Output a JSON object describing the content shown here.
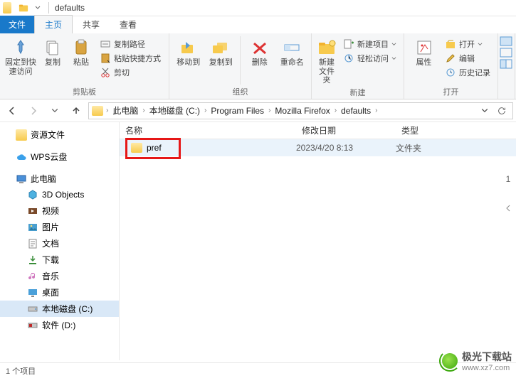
{
  "titlebar": {
    "title": "defaults"
  },
  "tabs": {
    "file": "文件",
    "home": "主页",
    "share": "共享",
    "view": "查看"
  },
  "ribbon": {
    "clipboard": {
      "pin": "固定到快\n速访问",
      "copy": "复制",
      "paste": "粘贴",
      "copy_path": "复制路径",
      "paste_shortcut": "粘贴快捷方式",
      "cut": "剪切",
      "group": "剪贴板"
    },
    "organize": {
      "moveto": "移动到",
      "copyto": "复制到",
      "delete": "删除",
      "rename": "重命名",
      "group": "组织"
    },
    "new": {
      "newfolder": "新建\n文件夹",
      "newitem": "新建项目",
      "easyaccess": "轻松访问",
      "group": "新建"
    },
    "open": {
      "properties": "属性",
      "open": "打开",
      "edit": "编辑",
      "history": "历史记录",
      "group": "打开"
    }
  },
  "breadcrumbs": [
    "此电脑",
    "本地磁盘 (C:)",
    "Program Files",
    "Mozilla Firefox",
    "defaults"
  ],
  "sidebar": {
    "res": "资源文件",
    "wps": "WPS云盘",
    "thispc": "此电脑",
    "items": [
      "3D Objects",
      "视频",
      "图片",
      "文档",
      "下载",
      "音乐",
      "桌面",
      "本地磁盘 (C:)",
      "软件 (D:)"
    ]
  },
  "columns": {
    "name": "名称",
    "date": "修改日期",
    "type": "类型"
  },
  "files": [
    {
      "name": "pref",
      "date": "2023/4/20 8:13",
      "type": "文件夹"
    }
  ],
  "status": {
    "count_prefix": "1 个项目"
  },
  "rightstrip": {
    "one": "1"
  },
  "watermark": {
    "text": "极光下载站",
    "url": "www.xz7.com"
  }
}
